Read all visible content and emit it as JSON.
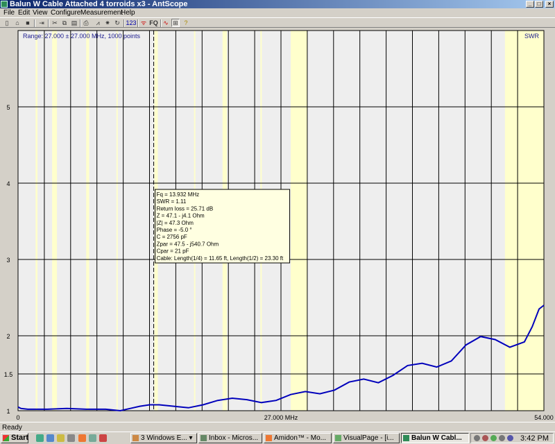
{
  "window": {
    "title": "Balun W Cable Attached 4 torroids x3 - AntScope"
  },
  "menu": [
    "File",
    "Edit",
    "View",
    "Configure",
    "Measurement",
    "Help"
  ],
  "toolbar": {
    "fq_label": "FQ",
    "num_label": "123"
  },
  "plot": {
    "range_text": "Range: 27.000 ± 27.000 MHz, 1000 points",
    "mode_label": "SWR",
    "x_center_label": "27.000 MHz",
    "colors": {
      "background": "#eeeeee",
      "band": "#ffffcc",
      "grid": "#000000",
      "trace": "#0000bb",
      "text": "#1a1a8c"
    }
  },
  "tooltip": {
    "lines": [
      "Fq = 13.932 MHz",
      "SWR = 1.11",
      "Return loss = 25.71 dB",
      "Z = 47.1 - j4.1 Ohm",
      "|Z| = 47.3 Ohm",
      "Phase = -5.0 °",
      "C = 2756 pF",
      "Zpar = 47.5 - j540.7 Ohm",
      "Cpar = 21 pF",
      "Cable: Length(1/4) = 11.65 ft, Length(1/2) = 23.30 ft"
    ]
  },
  "chart_data": {
    "type": "line",
    "x_unit": "MHz",
    "xlim": [
      0,
      54
    ],
    "x_tick_labels": [
      "0",
      "27.000 MHz",
      "54.000"
    ],
    "y_tick_labels": [
      "1",
      "1.5",
      "2",
      "3",
      "4",
      "5"
    ],
    "y_ticks": [
      1,
      1.5,
      2,
      3,
      4,
      5
    ],
    "grid": true,
    "cursor_x": 13.932,
    "highlight_bands_mhz": [
      [
        1.8,
        2.0
      ],
      [
        3.5,
        4.0
      ],
      [
        7.0,
        7.3
      ],
      [
        10.1,
        10.15
      ],
      [
        14.0,
        14.35
      ],
      [
        18.068,
        18.168
      ],
      [
        21.0,
        21.45
      ],
      [
        24.89,
        24.99
      ],
      [
        28.0,
        29.7
      ],
      [
        50.0,
        54.0
      ]
    ],
    "series": [
      {
        "x": [
          0,
          0.3,
          1,
          3,
          5,
          7,
          9,
          10.5,
          11.5,
          12.5,
          13.5,
          14.5,
          16,
          17.5,
          19,
          20.5,
          22,
          23.5,
          25,
          26.5,
          28,
          29.5,
          31,
          32.5,
          34,
          35.5,
          37,
          38.5,
          40,
          41.5,
          43,
          44.5,
          46,
          47.5,
          49,
          50.5,
          52,
          52.8,
          53.5,
          54
        ],
        "y": [
          1.05,
          1.03,
          1.02,
          1.02,
          1.03,
          1.02,
          1.02,
          1.0,
          1.03,
          1.06,
          1.08,
          1.08,
          1.06,
          1.04,
          1.08,
          1.14,
          1.17,
          1.15,
          1.11,
          1.14,
          1.22,
          1.26,
          1.23,
          1.28,
          1.39,
          1.43,
          1.38,
          1.48,
          1.61,
          1.64,
          1.59,
          1.67,
          1.88,
          1.99,
          1.95,
          1.85,
          1.92,
          2.12,
          2.35,
          2.4
        ]
      }
    ]
  }
}
